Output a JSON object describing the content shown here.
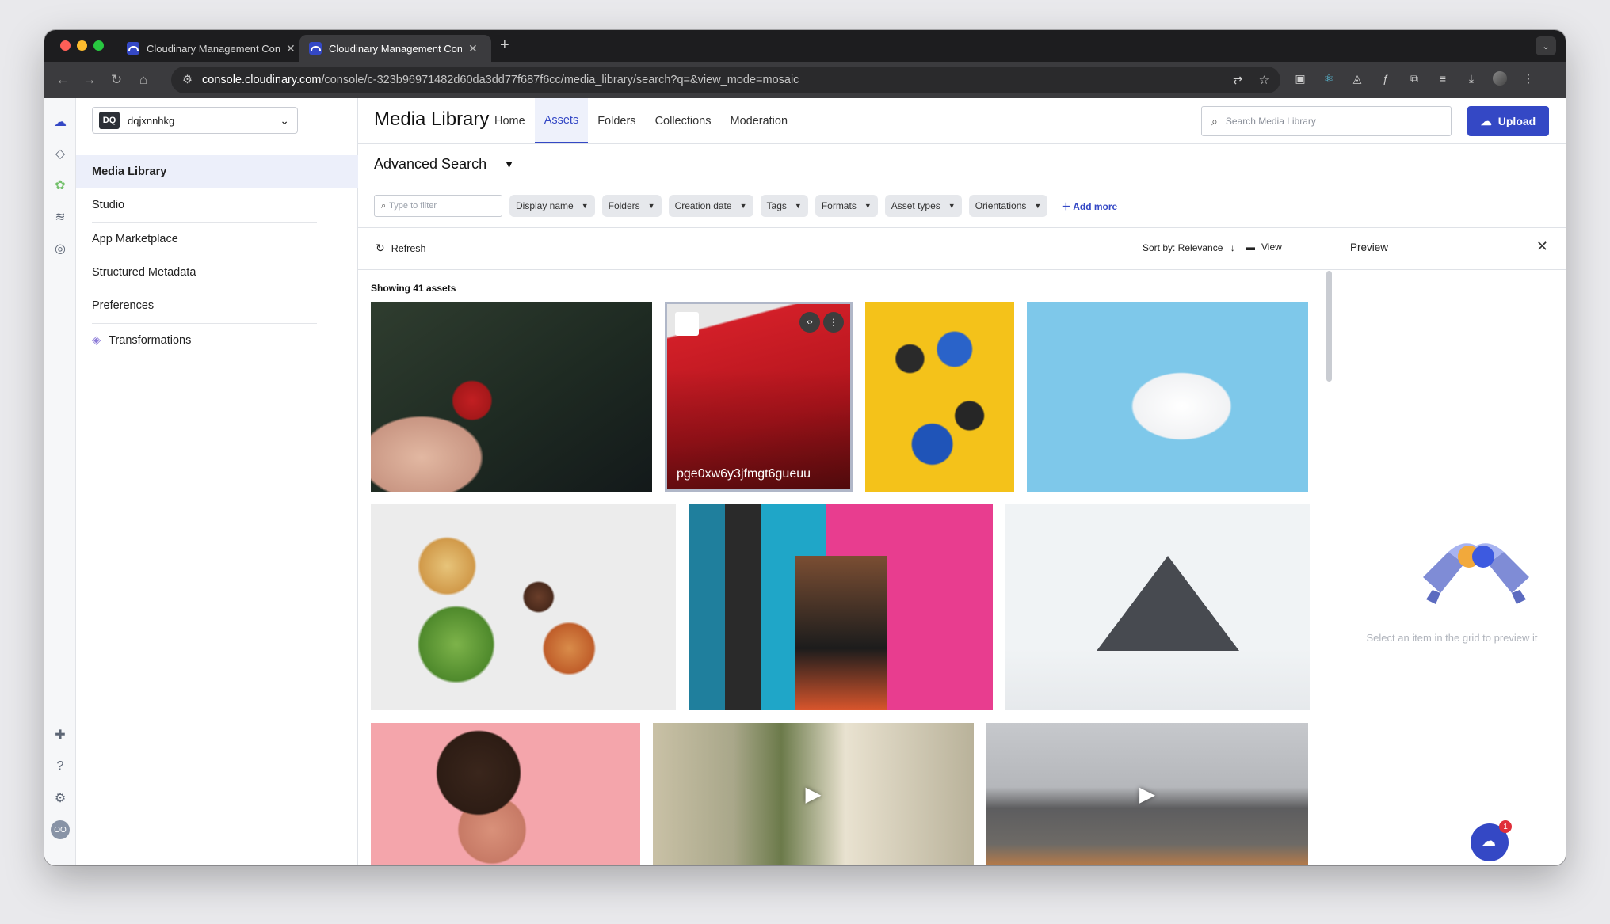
{
  "browser": {
    "tabs": [
      {
        "title": "Cloudinary Management Con",
        "active": false
      },
      {
        "title": "Cloudinary Management Con",
        "active": true
      }
    ],
    "new_tab": "+",
    "url_domain": "console.cloudinary.com",
    "url_path": "/console/c-323b96971482d60da3dd77f687f6cc/media_library/search?q=&view_mode=mosaic"
  },
  "sidebar": {
    "env_badge": "DQ",
    "env_name": "dqjxnnhkg",
    "items": [
      {
        "label": "Media Library",
        "active": true
      },
      {
        "label": "Studio"
      },
      {
        "label": "App Marketplace"
      },
      {
        "label": "Structured Metadata"
      },
      {
        "label": "Preferences"
      },
      {
        "label": "Transformations"
      }
    ]
  },
  "header": {
    "title": "Media Library",
    "tabs": [
      "Home",
      "Assets",
      "Folders",
      "Collections",
      "Moderation"
    ],
    "active_tab": "Assets",
    "search_placeholder": "Search Media Library",
    "upload_label": "Upload"
  },
  "search": {
    "title": "Advanced Search",
    "filter_placeholder": "Type to filter",
    "chips": [
      "Display name",
      "Folders",
      "Creation date",
      "Tags",
      "Formats",
      "Asset types",
      "Orientations"
    ],
    "add_more": "Add more"
  },
  "actions": {
    "refresh": "Refresh",
    "sort": "Sort by: Relevance",
    "view": "View"
  },
  "results": {
    "showing": "Showing 41 assets",
    "selected_asset_name": "pge0xw6y3jfmgt6gueuu"
  },
  "preview": {
    "title": "Preview",
    "empty_message": "Select an item in the grid to preview it"
  },
  "chat": {
    "notification_count": "1"
  },
  "colors": {
    "accent": "#3448c5",
    "notification": "#e02f3a"
  }
}
